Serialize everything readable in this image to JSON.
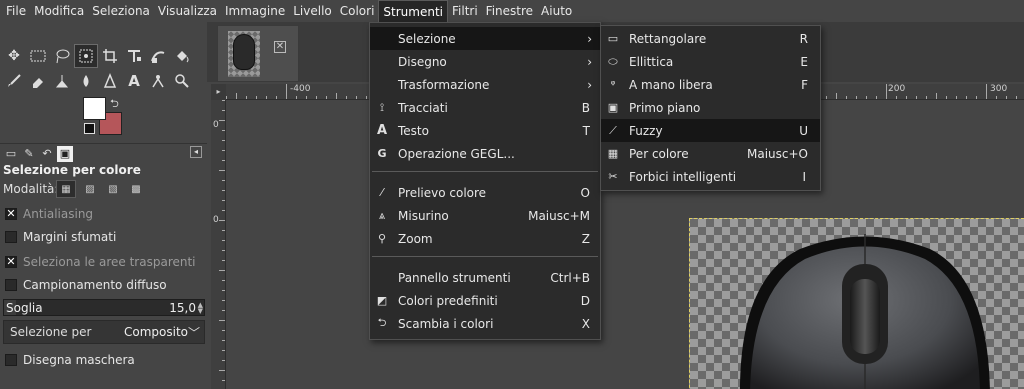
{
  "menubar": {
    "items": [
      "File",
      "Modifica",
      "Seleziona",
      "Visualizza",
      "Immagine",
      "Livello",
      "Colori",
      "Strumenti",
      "Filtri",
      "Finestre",
      "Aiuto"
    ],
    "active_index": 7
  },
  "toolbox": {
    "row1_icons": [
      "move-icon",
      "rect-select-icon",
      "lasso-icon",
      "fuzzy-select-icon",
      "crop-icon",
      "unified-transform-icon",
      "warp-icon",
      "bucket-fill-icon"
    ],
    "row2_icons": [
      "paintbrush-icon",
      "eraser-icon",
      "clone-icon",
      "smudge-icon",
      "ink-icon",
      "text-icon",
      "path-icon",
      "zoom-icon"
    ],
    "fg_color": "#ffffff",
    "bg_color": "#b5565a"
  },
  "tool_options": {
    "title": "Selezione per colore",
    "mode_label": "Modalità:",
    "antialiasing": {
      "label": "Antialiasing",
      "checked": true
    },
    "feather": {
      "label": "Margini sfumati",
      "checked": false
    },
    "transparent": {
      "label": "Seleziona le aree trasparenti",
      "checked": true
    },
    "sample_merged": {
      "label": "Campionamento diffuso",
      "checked": false
    },
    "threshold": {
      "label": "Soglia",
      "value": "15,0",
      "fraction": 0.06
    },
    "select_by": {
      "label": "Selezione per",
      "value": "Composito"
    },
    "draw_mask": {
      "label": "Disegna maschera",
      "checked": false
    }
  },
  "ruler": {
    "h_labels": [
      "-400",
      "200",
      "300"
    ],
    "v_labels": [
      "0",
      "0"
    ]
  },
  "strumenti_menu": {
    "items": [
      {
        "icon": "",
        "label": "Selezione",
        "shortcut": "",
        "submenu": true,
        "highlight": true
      },
      {
        "icon": "",
        "label": "Disegno",
        "shortcut": "",
        "submenu": true
      },
      {
        "icon": "",
        "label": "Trasformazione",
        "shortcut": "",
        "submenu": true
      },
      {
        "icon": "paths-icon",
        "label": "Tracciati",
        "shortcut": "B"
      },
      {
        "icon": "text-icon",
        "label": "Testo",
        "shortcut": "T"
      },
      {
        "icon": "gegl-icon",
        "label": "Operazione GEGL...",
        "shortcut": ""
      },
      {
        "icon": "color-picker-icon",
        "label": "Prelievo colore",
        "shortcut": "O"
      },
      {
        "icon": "measure-icon",
        "label": "Misurino",
        "shortcut": "Maiusc+M"
      },
      {
        "icon": "zoom-icon",
        "label": "Zoom",
        "shortcut": "Z"
      },
      {
        "icon": "",
        "label": "Pannello strumenti",
        "shortcut": "Ctrl+B"
      },
      {
        "icon": "default-colors-icon",
        "label": "Colori predefiniti",
        "shortcut": "D"
      },
      {
        "icon": "swap-colors-icon",
        "label": "Scambia i colori",
        "shortcut": "X"
      }
    ]
  },
  "selezione_submenu": {
    "items": [
      {
        "icon": "rect-select-icon",
        "label": "Rettangolare",
        "shortcut": "R"
      },
      {
        "icon": "ellipse-select-icon",
        "label": "Ellittica",
        "shortcut": "E"
      },
      {
        "icon": "lasso-icon",
        "label": "A mano libera",
        "shortcut": "F"
      },
      {
        "icon": "foreground-select-icon",
        "label": "Primo piano",
        "shortcut": ""
      },
      {
        "icon": "fuzzy-select-icon",
        "label": "Fuzzy",
        "shortcut": "U",
        "highlight": true
      },
      {
        "icon": "color-select-icon",
        "label": "Per colore",
        "shortcut": "Maiusc+O"
      },
      {
        "icon": "scissors-icon",
        "label": "Forbici intelligenti",
        "shortcut": "I"
      }
    ]
  }
}
